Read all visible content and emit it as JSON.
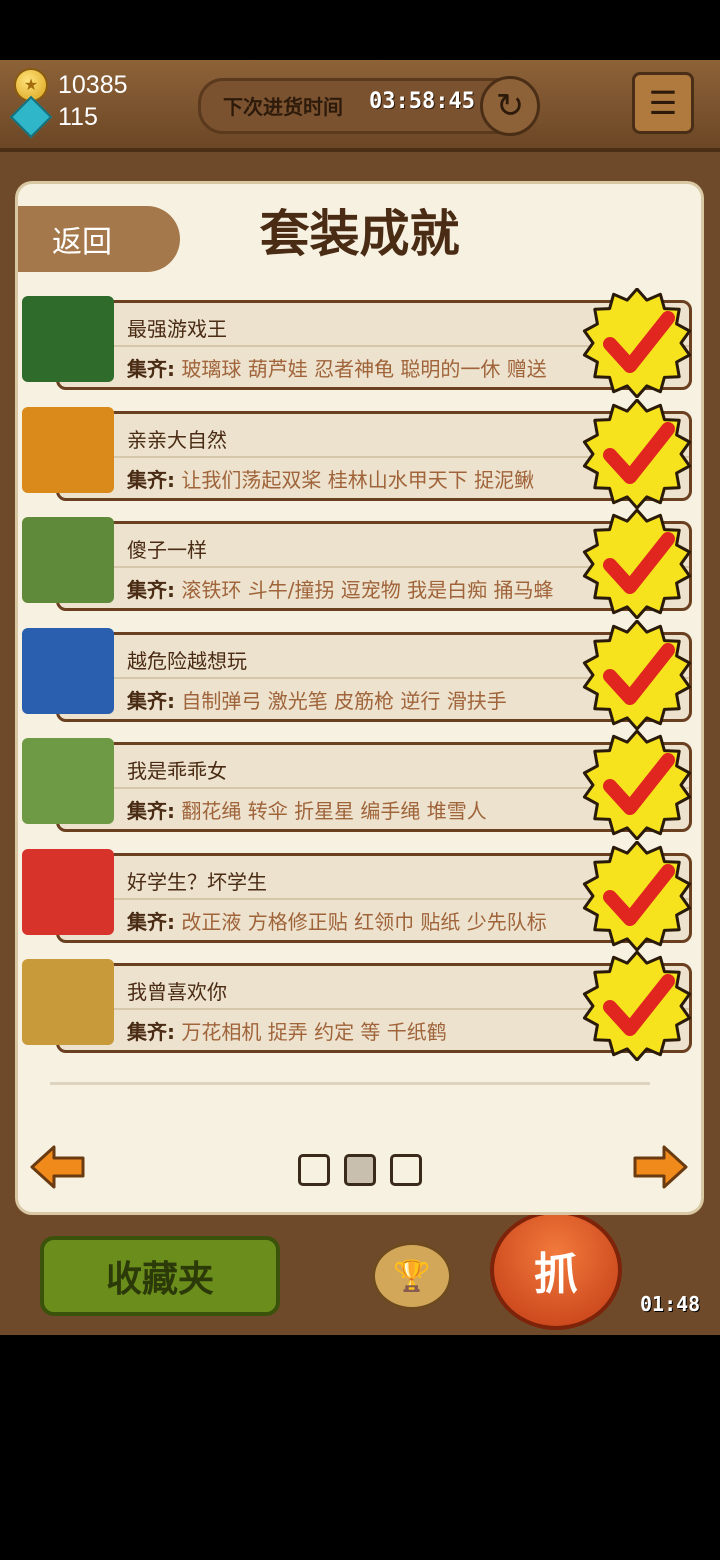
{
  "header": {
    "coins": "10385",
    "gems": "115",
    "restock_label": "下次进货时间",
    "restock_timer": "03:58:45"
  },
  "panel": {
    "back_label": "返回",
    "title": "套装成就",
    "sets": [
      {
        "name": "最强游戏王",
        "label": "集齐:",
        "items": "玻璃球 葫芦娃 忍者神龟 聪明的一休 赠送",
        "thumb_color": "#2f6b2a"
      },
      {
        "name": "亲亲大自然",
        "label": "集齐:",
        "items": "让我们荡起双桨 桂林山水甲天下 捉泥鳅",
        "thumb_color": "#d98a1a"
      },
      {
        "name": "傻子一样",
        "label": "集齐:",
        "items": "滚铁环 斗牛/撞拐 逗宠物 我是白痴 捅马蜂",
        "thumb_color": "#5f8a3a"
      },
      {
        "name": "越危险越想玩",
        "label": "集齐:",
        "items": "自制弹弓 激光笔 皮筋枪 逆行 滑扶手",
        "thumb_color": "#2a5fb0"
      },
      {
        "name": "我是乖乖女",
        "label": "集齐:",
        "items": "翻花绳 转伞 折星星 编手绳 堆雪人",
        "thumb_color": "#6f9a45"
      },
      {
        "name": "好学生？坏学生",
        "label": "集齐:",
        "items": "改正液 方格修正贴 红领巾 贴纸 少先队标",
        "thumb_color": "#d8332a"
      },
      {
        "name": "我曾喜欢你",
        "label": "集齐:",
        "items": "万花相机 捉弄 约定 等 千纸鹤",
        "thumb_color": "#c89a3a"
      }
    ],
    "current_page": 2,
    "total_pages": 3
  },
  "bottom": {
    "favorites_label": "收藏夹",
    "grab_label": "抓",
    "timer": "01:48"
  },
  "colors": {
    "panel_bg": "#f7f1e1",
    "row_border": "#6a4020",
    "seal_yellow": "#f7e21e",
    "check_red": "#e0261e",
    "arrow_orange": "#f08a1a"
  }
}
